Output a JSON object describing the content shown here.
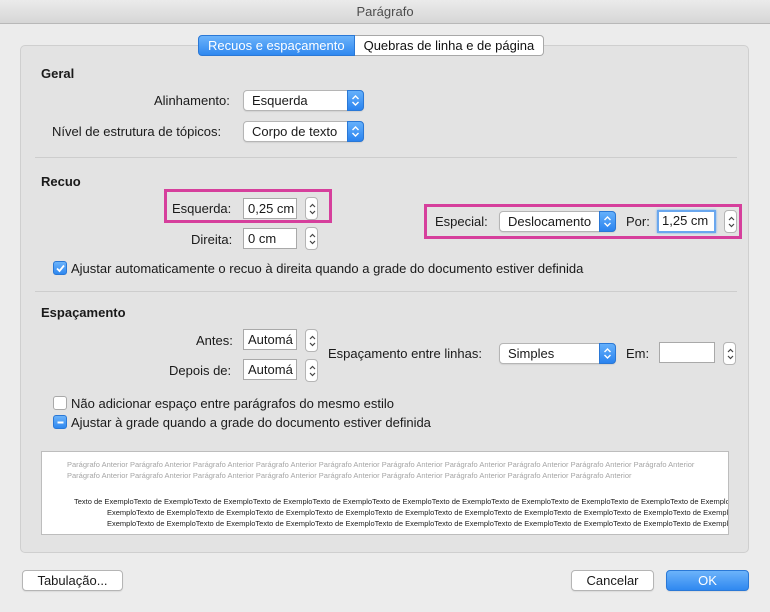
{
  "window": {
    "title": "Parágrafo"
  },
  "tabs": [
    {
      "label": "Recuos e espaçamento",
      "active": true
    },
    {
      "label": "Quebras de linha e de página",
      "active": false
    }
  ],
  "geral": {
    "heading": "Geral",
    "alinhamento_label": "Alinhamento:",
    "alinhamento_value": "Esquerda",
    "nivel_label": "Nível de estrutura de tópicos:",
    "nivel_value": "Corpo de texto"
  },
  "recuo": {
    "heading": "Recuo",
    "esquerda_label": "Esquerda:",
    "esquerda_value": "0,25 cm",
    "direita_label": "Direita:",
    "direita_value": "0 cm",
    "especial_label": "Especial:",
    "especial_value": "Deslocamento",
    "por_label": "Por:",
    "por_value": "1,25 cm",
    "auto_checkbox_label": "Ajustar automaticamente o recuo à direita quando a grade do documento estiver definida",
    "auto_checkbox_checked": true
  },
  "espacamento": {
    "heading": "Espaçamento",
    "antes_label": "Antes:",
    "antes_value": "Automá",
    "depois_label": "Depois de:",
    "depois_value": "Automá",
    "entre_linhas_label": "Espaçamento entre linhas:",
    "entre_linhas_value": "Simples",
    "em_label": "Em:",
    "em_value": "",
    "nao_adicionar_label": "Não adicionar espaço entre parágrafos do mesmo estilo",
    "nao_adicionar_checked": false,
    "ajustar_grade_label": "Ajustar à grade quando a grade do documento estiver definida",
    "ajustar_grade_state": "mixed"
  },
  "preview": {
    "previous_text": "Parágrafo Anterior Parágrafo Anterior Parágrafo Anterior Parágrafo Anterior Parágrafo Anterior Parágrafo Anterior Parágrafo Anterior Parágrafo Anterior Parágrafo Anterior Parágrafo Anterior Parágrafo Anterior Parágrafo Anterior Parágrafo Anterior Parágrafo Anterior Parágrafo Anterior Parágrafo Anterior Parágrafo Anterior Parágrafo Anterior Parágrafo Anterior",
    "sample_line_1": "Texto de ExemploTexto de ExemploTexto de ExemploTexto de ExemploTexto de ExemploTexto de ExemploTexto de ExemploTexto de ExemploTexto de ExemploTexto de ExemploTexto de Exemplo",
    "sample_line_2": "ExemploTexto de ExemploTexto de ExemploTexto de ExemploTexto de ExemploTexto de ExemploTexto de ExemploTexto de ExemploTexto de ExemploTexto de ExemploTexto de ExemploTexto de",
    "sample_line_3": "ExemploTexto de ExemploTexto de ExemploTexto de ExemploTexto de ExemploTexto de ExemploTexto de ExemploTexto de ExemploTexto de ExemploTexto de ExemploTexto de Exemplo"
  },
  "buttons": {
    "tabulacao": "Tabulação...",
    "cancelar": "Cancelar",
    "ok": "OK"
  },
  "colors": {
    "accent": "#2f88f0",
    "highlight": "#d63f9c"
  }
}
